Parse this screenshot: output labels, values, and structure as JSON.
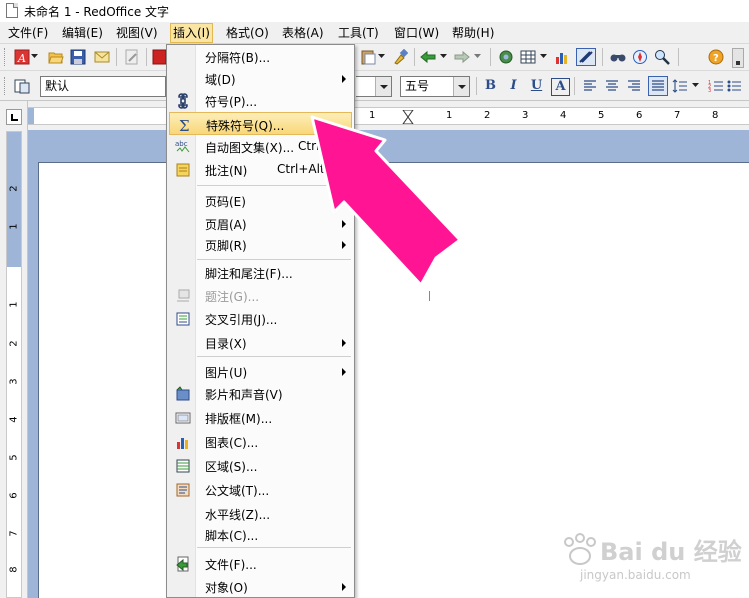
{
  "window": {
    "title": "未命名 1 - RedOffice 文字"
  },
  "menubar": [
    {
      "label": "文件(F)",
      "active": false
    },
    {
      "label": "编辑(E)",
      "active": false
    },
    {
      "label": "视图(V)",
      "active": false
    },
    {
      "label": "插入(I)",
      "active": true
    },
    {
      "label": "格式(O)",
      "active": false
    },
    {
      "label": "表格(A)",
      "active": false
    },
    {
      "label": "工具(T)",
      "active": false
    },
    {
      "label": "窗口(W)",
      "active": false
    },
    {
      "label": "帮助(H)",
      "active": false
    }
  ],
  "formatting": {
    "paragraph_style": "默认",
    "font_size": "五号",
    "bold": "B",
    "italic": "I",
    "underline": "U",
    "shadow": "A"
  },
  "rulers": {
    "horizontal": [
      "1",
      "1",
      "2",
      "3",
      "4",
      "5",
      "6",
      "7",
      "8",
      "9"
    ],
    "vertical": [
      "2",
      "1",
      "1",
      "2",
      "3",
      "4",
      "5",
      "6",
      "7",
      "8"
    ]
  },
  "insert_menu": {
    "items": [
      {
        "label": "分隔符(B)...",
        "shortcut": "",
        "submenu": false,
        "disabled": false,
        "highlighted": false,
        "icon": ""
      },
      {
        "label": "域(D)",
        "shortcut": "",
        "submenu": true,
        "disabled": false,
        "highlighted": false,
        "icon": ""
      },
      {
        "label": "符号(P)...",
        "shortcut": "",
        "submenu": false,
        "disabled": false,
        "highlighted": false,
        "icon": "symbol-icon"
      },
      {
        "label": "特殊符号(Q)...",
        "shortcut": "",
        "submenu": false,
        "disabled": false,
        "highlighted": true,
        "icon": "sigma-icon"
      },
      {
        "label": "自动图文集(X)...",
        "shortcut": "Ctrl",
        "submenu": false,
        "disabled": false,
        "highlighted": false,
        "icon": "autotext-icon"
      },
      {
        "label": "批注(N)",
        "shortcut": "Ctrl+Alt+N",
        "submenu": false,
        "disabled": false,
        "highlighted": false,
        "icon": "comment-icon"
      },
      {
        "label": "页码(E)",
        "shortcut": "",
        "submenu": false,
        "disabled": false,
        "highlighted": false,
        "icon": ""
      },
      {
        "label": "页眉(A)",
        "shortcut": "",
        "submenu": true,
        "disabled": false,
        "highlighted": false,
        "icon": ""
      },
      {
        "label": "页脚(R)",
        "shortcut": "",
        "submenu": true,
        "disabled": false,
        "highlighted": false,
        "icon": ""
      },
      {
        "label": "脚注和尾注(F)...",
        "shortcut": "",
        "submenu": false,
        "disabled": false,
        "highlighted": false,
        "icon": ""
      },
      {
        "label": "题注(G)...",
        "shortcut": "",
        "submenu": false,
        "disabled": true,
        "highlighted": false,
        "icon": "caption-icon"
      },
      {
        "label": "交叉引用(J)...",
        "shortcut": "",
        "submenu": false,
        "disabled": false,
        "highlighted": false,
        "icon": "cross-reference-icon"
      },
      {
        "label": "目录(X)",
        "shortcut": "",
        "submenu": true,
        "disabled": false,
        "highlighted": false,
        "icon": ""
      },
      {
        "label": "图片(U)",
        "shortcut": "",
        "submenu": true,
        "disabled": false,
        "highlighted": false,
        "icon": ""
      },
      {
        "label": "影片和声音(V)",
        "shortcut": "",
        "submenu": false,
        "disabled": false,
        "highlighted": false,
        "icon": "movie-icon"
      },
      {
        "label": "排版框(M)...",
        "shortcut": "",
        "submenu": false,
        "disabled": false,
        "highlighted": false,
        "icon": "frame-icon"
      },
      {
        "label": "图表(C)...",
        "shortcut": "",
        "submenu": false,
        "disabled": false,
        "highlighted": false,
        "icon": "chart-icon"
      },
      {
        "label": "区域(S)...",
        "shortcut": "",
        "submenu": false,
        "disabled": false,
        "highlighted": false,
        "icon": "section-icon"
      },
      {
        "label": "公文域(T)...",
        "shortcut": "",
        "submenu": false,
        "disabled": false,
        "highlighted": false,
        "icon": "document-field-icon"
      },
      {
        "label": "水平线(Z)...",
        "shortcut": "",
        "submenu": false,
        "disabled": false,
        "highlighted": false,
        "icon": ""
      },
      {
        "label": "脚本(C)...",
        "shortcut": "",
        "submenu": false,
        "disabled": false,
        "highlighted": false,
        "icon": ""
      },
      {
        "label": "文件(F)...",
        "shortcut": "",
        "submenu": false,
        "disabled": false,
        "highlighted": false,
        "icon": "file-icon"
      },
      {
        "label": "对象(O)",
        "shortcut": "",
        "submenu": true,
        "disabled": false,
        "highlighted": false,
        "icon": ""
      }
    ]
  },
  "watermark": {
    "brand": "Bai du 经验",
    "url": "jingyan.baidu.com"
  },
  "colors": {
    "annotation_arrow": "#ff1493",
    "menu_highlight": "#f8d77a",
    "doc_background": "#9fb5d8"
  }
}
